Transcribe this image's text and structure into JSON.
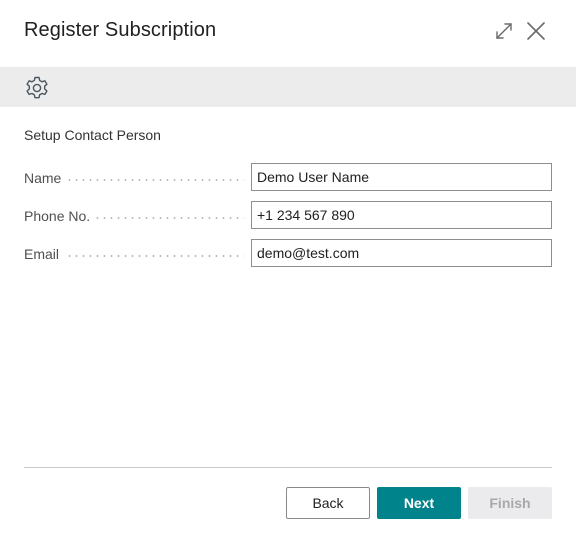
{
  "dialog": {
    "title": "Register Subscription",
    "header_icons": [
      "expand-icon",
      "close-icon"
    ],
    "actionbar_icons": [
      "gear-icon"
    ]
  },
  "section": {
    "title": "Setup Contact Person"
  },
  "fields": [
    {
      "label": "Name",
      "value": "Demo User Name"
    },
    {
      "label": "Phone No.",
      "value": "+1 234 567 890"
    },
    {
      "label": "Email",
      "value": "demo@test.com"
    }
  ],
  "buttons": {
    "back": "Back",
    "next": "Next",
    "finish": "Finish"
  },
  "colors": {
    "primary": "#00838a",
    "actionbar": "#ececec",
    "disabled_bg": "#ebebed"
  }
}
